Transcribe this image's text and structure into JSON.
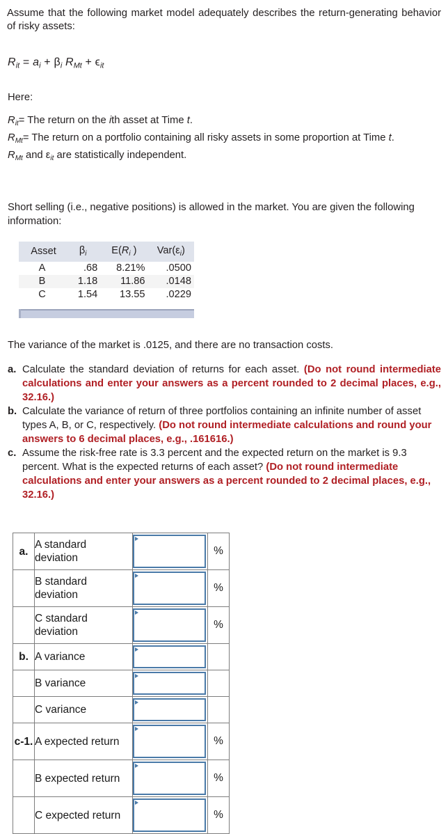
{
  "intro": {
    "paragraph": "Assume that the following market model adequately describes the return-generating behavior of risky assets:",
    "here_label": "Here:"
  },
  "equation": {
    "lhs_base": "R",
    "lhs_sub": "it",
    "eq_sign": "=",
    "alpha_base": "a",
    "alpha_sub": "i",
    "plus1": "+",
    "beta_base": "β",
    "beta_sub": "i",
    "rm_base": "R",
    "rm_sub": "Mt",
    "plus2": "+",
    "eps_base": "ϵ",
    "eps_sub": "it",
    "full": "R_it = a_i + β_i R_Mt + ϵ_it"
  },
  "definitions": [
    {
      "symbol_base": "R",
      "symbol_sub": "it",
      "text_pre": "= The return on the ",
      "italic": "i",
      "text_post": "th asset at Time t."
    },
    {
      "symbol_base": "R",
      "symbol_sub": "Mt",
      "text_pre": "= The return on a portfolio containing all risky assets in some proportion at Time ",
      "italic": "t",
      "text_post": "."
    },
    {
      "symbol_base": "R",
      "symbol_sub": "Mt",
      "text_pre": " and ",
      "italic": "ε",
      "italic_sub": "it",
      "text_post": " are statistically independent."
    }
  ],
  "short_selling": "Short selling (i.e., negative positions) is allowed in the market. You are given the following information:",
  "data_table": {
    "headers": [
      "Asset",
      "β",
      "E(R )",
      "Var(ε)"
    ],
    "header_subs": [
      "",
      "i",
      "i",
      "i"
    ],
    "rows": [
      {
        "asset": "A",
        "beta": ".68",
        "er": "8.21%",
        "var": ".0500"
      },
      {
        "asset": "B",
        "beta": "1.18",
        "er": "11.86",
        "var": ".0148"
      },
      {
        "asset": "C",
        "beta": "1.54",
        "er": "13.55",
        "var": ".0229"
      }
    ]
  },
  "market_variance_text": "The variance of the market is .0125, and there are no transaction costs.",
  "questions": [
    {
      "label": "a.",
      "text": "Calculate the standard deviation of returns for each asset. ",
      "emphasis": "(Do not round intermediate calculations and enter your answers as a percent rounded to 2 decimal places, e.g., 32.16.)"
    },
    {
      "label": "b.",
      "text": "Calculate the variance of return of three portfolios containing an infinite number of asset types A, B, or C, respectively. ",
      "emphasis": "(Do not round intermediate calculations and round your answers to 6 decimal places, e.g., .161616.)"
    },
    {
      "label": "c.",
      "text": "Assume the risk-free rate is 3.3 percent and the expected return on the market is 9.3 percent. What is the expected returns of each asset? ",
      "emphasis": "(Do not round intermediate calculations and enter your answers as a percent rounded to 2 decimal places, e.g., 32.16.)"
    }
  ],
  "answer_table": {
    "rows": [
      {
        "label": "a.",
        "name": "A standard deviation",
        "value": "",
        "unit": "%",
        "size": "tall"
      },
      {
        "label": "",
        "name": "B standard deviation",
        "value": "",
        "unit": "%",
        "size": "tall"
      },
      {
        "label": "",
        "name": "C standard deviation",
        "value": "",
        "unit": "%",
        "size": "tall"
      },
      {
        "label": "b.",
        "name": "A variance",
        "value": "",
        "unit": "",
        "size": "short"
      },
      {
        "label": "",
        "name": "B variance",
        "value": "",
        "unit": "",
        "size": "short"
      },
      {
        "label": "",
        "name": "C variance",
        "value": "",
        "unit": "",
        "size": "short"
      },
      {
        "label": "c-1.",
        "name": "A expected return",
        "value": "",
        "unit": "%",
        "size": "tall"
      },
      {
        "label": "",
        "name": "B expected return",
        "value": "",
        "unit": "%",
        "size": "tall"
      },
      {
        "label": "",
        "name": "C expected return",
        "value": "",
        "unit": "%",
        "size": "tall"
      }
    ]
  },
  "colors": {
    "emphasis_red": "#b01f24",
    "table_header_bg": "#dfe3ec",
    "input_border": "#4a7aa8",
    "scrollbar": "#c6cde0"
  }
}
